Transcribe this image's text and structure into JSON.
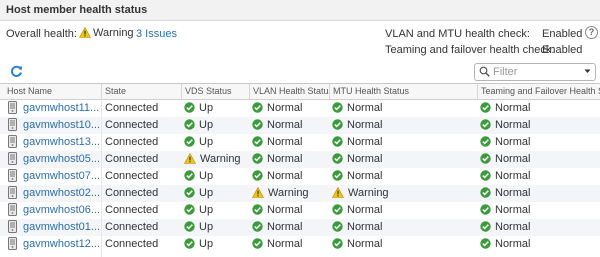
{
  "header": {
    "title": "Host member health status"
  },
  "summary": {
    "overall_label": "Overall health:",
    "overall_status": "Warning",
    "issues_link": "3 Issues",
    "vlan_mtu_label": "VLAN and MTU health check:",
    "vlan_mtu_value": "Enabled",
    "teaming_label": "Teaming and failover health check:",
    "teaming_value": "Enabled"
  },
  "filter": {
    "placeholder": "Filter"
  },
  "table": {
    "columns": [
      "Host Name",
      "State",
      "VDS Status",
      "VLAN Health Status",
      "MTU Health Status",
      "Teaming and Failover Health Stat"
    ],
    "rows": [
      {
        "host": "gavmwhost11...",
        "state": "Connected",
        "vds": "Up",
        "vlan": "Normal",
        "mtu": "Normal",
        "tf": "Normal"
      },
      {
        "host": "gavmwhost10...",
        "state": "Connected",
        "vds": "Up",
        "vlan": "Normal",
        "mtu": "Normal",
        "tf": "Normal"
      },
      {
        "host": "gavmwhost13...",
        "state": "Connected",
        "vds": "Up",
        "vlan": "Normal",
        "mtu": "Normal",
        "tf": "Normal"
      },
      {
        "host": "gavmwhost05...",
        "state": "Connected",
        "vds": "Warning",
        "vlan": "Normal",
        "mtu": "Normal",
        "tf": "Normal"
      },
      {
        "host": "gavmwhost07...",
        "state": "Connected",
        "vds": "Up",
        "vlan": "Normal",
        "mtu": "Normal",
        "tf": "Normal"
      },
      {
        "host": "gavmwhost02...",
        "state": "Connected",
        "vds": "Up",
        "vlan": "Warning",
        "mtu": "Warning",
        "tf": "Normal"
      },
      {
        "host": "gavmwhost06...",
        "state": "Connected",
        "vds": "Up",
        "vlan": "Normal",
        "mtu": "Normal",
        "tf": "Normal"
      },
      {
        "host": "gavmwhost01...",
        "state": "Connected",
        "vds": "Up",
        "vlan": "Normal",
        "mtu": "Normal",
        "tf": "Normal"
      },
      {
        "host": "gavmwhost12...",
        "state": "Connected",
        "vds": "Up",
        "vlan": "Normal",
        "mtu": "Normal",
        "tf": "Normal"
      }
    ]
  },
  "colors": {
    "ok": "#3c9a3c",
    "warning": "#f0c419",
    "link": "#2e6ea8",
    "refresh": "#2e7fd1"
  },
  "icons": {
    "ok": "check-circle-icon",
    "warning": "warning-triangle-icon",
    "host": "server-host-icon",
    "refresh": "refresh-icon",
    "search": "search-icon",
    "help": "help-icon"
  }
}
